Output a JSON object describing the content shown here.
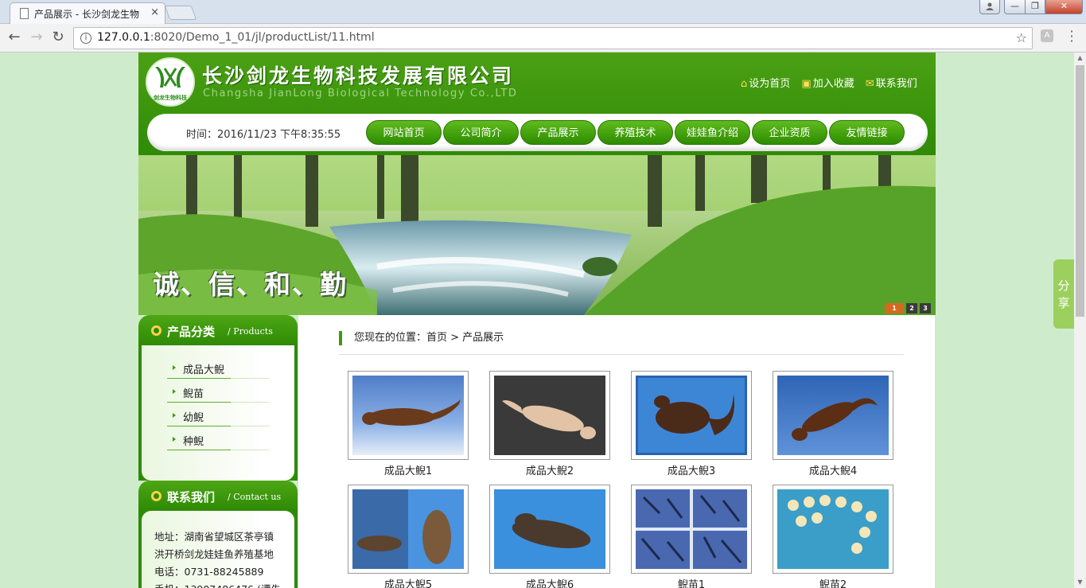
{
  "browser": {
    "tab_title": "产品展示 - 长沙剑龙生物",
    "tab_close": "×",
    "url_host": "127.0.0.1",
    "url_path": ":8020/Demo_1_01/jl/productList/11.html",
    "win_min": "—",
    "win_max": "❐",
    "win_close": "✕",
    "ext_label": "A"
  },
  "header": {
    "logo_mark": "𝕏",
    "logo_text": "剑龙生物科技",
    "company_name": "长沙剑龙生物科技发展有限公司",
    "company_name_en": "Changsha JianLong Biological Technology Co.,LTD",
    "links": [
      "设为首页",
      "加入收藏",
      "联系我们"
    ],
    "link_icons": [
      "⌂",
      "▣",
      "✉"
    ]
  },
  "nav": {
    "time_label": "时间：2016/11/23 下午8:35:55",
    "items": [
      "网站首页",
      "公司简介",
      "产品展示",
      "养殖技术",
      "娃娃鱼介绍",
      "企业资质",
      "友情链接"
    ]
  },
  "banner": {
    "slogan": "诚、信、和、勤",
    "dots": [
      "1",
      "2",
      "3"
    ],
    "active_dot": 1
  },
  "sidebar": {
    "products": {
      "title": "产品分类",
      "title_en": "/ Products",
      "items": [
        "成品大鲵",
        "鲵苗",
        "幼鲵",
        "种鲵"
      ]
    },
    "contact": {
      "title": "联系我们",
      "title_en": "/ Contact us",
      "lines": [
        "地址：湖南省望城区茶亭镇",
        "洪开桥剑龙娃娃鱼养殖基地",
        "电话：0731-88245889",
        "手机：13907486476 (谭先"
      ]
    }
  },
  "main": {
    "breadcrumb": "您现在的位置：首页 > 产品展示",
    "products": [
      "成品大鲵1",
      "成品大鲵2",
      "成品大鲵3",
      "成品大鲵4",
      "成品大鲵5",
      "成品大鲵6",
      "鲵苗1",
      "鲵苗2"
    ]
  },
  "share": {
    "label": "分享"
  },
  "colors": {
    "brand_green": "#2e8a04",
    "page_bg": "#ceeccb",
    "share_green": "#9bd05e"
  }
}
